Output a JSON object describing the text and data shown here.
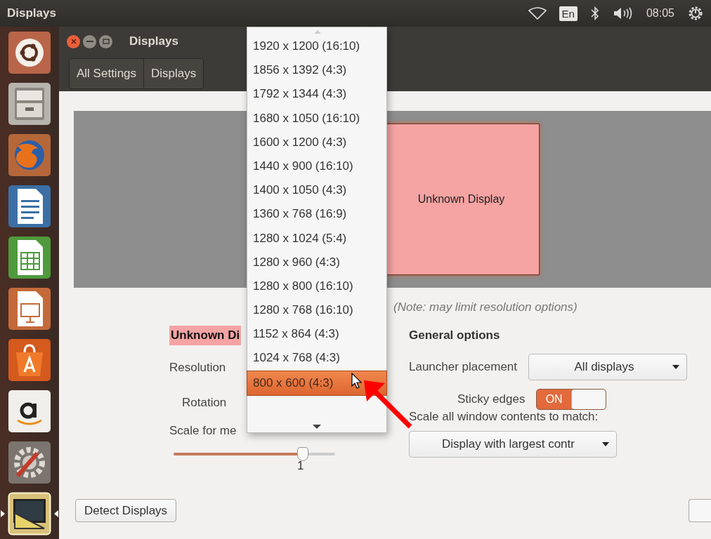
{
  "top_bar": {
    "title": "Displays",
    "keyboard": "En",
    "clock": "08:05"
  },
  "launcher": [
    {
      "kind": "ubuntu",
      "running": false
    },
    {
      "kind": "files",
      "running": false
    },
    {
      "kind": "browser",
      "running": false
    },
    {
      "kind": "writer",
      "running": false
    },
    {
      "kind": "calc",
      "running": false
    },
    {
      "kind": "impress",
      "running": false
    },
    {
      "kind": "store",
      "running": false
    },
    {
      "kind": "amazon",
      "running": false
    },
    {
      "kind": "settings",
      "running": false
    },
    {
      "kind": "display",
      "running": true
    }
  ],
  "window": {
    "title": "Displays",
    "breadcrumbs": [
      "All Settings",
      "Displays"
    ]
  },
  "preview": {
    "display_label": "Unknown Display"
  },
  "note": "(Note: may limit resolution options)",
  "display_section": {
    "heading": "Unknown Di",
    "resolution_label": "Resolution",
    "rotation_label": "Rotation",
    "scale_label": "Scale for me",
    "scale": {
      "level": 0.8,
      "value": "1"
    }
  },
  "general": {
    "heading": "General options",
    "launcher_label": "Launcher placement",
    "launcher_value": "All displays",
    "sticky_label": "Sticky edges",
    "sticky": {
      "on": true,
      "label": "ON"
    },
    "scale_all_label": "Scale all window contents to match:",
    "scale_all_value": "Display with largest contr"
  },
  "detect_button": "Detect Displays",
  "resolution_menu": [
    {
      "label": "1920 x 1200 (16:10)",
      "selected": false
    },
    {
      "label": "1856 x 1392 (4:3)",
      "selected": false
    },
    {
      "label": "1792 x 1344 (4:3)",
      "selected": false
    },
    {
      "label": "1680 x 1050 (16:10)",
      "selected": false
    },
    {
      "label": "1600 x 1200 (4:3)",
      "selected": false
    },
    {
      "label": "1440 x 900 (16:10)",
      "selected": false
    },
    {
      "label": "1400 x 1050 (4:3)",
      "selected": false
    },
    {
      "label": "1360 x 768 (16:9)",
      "selected": false
    },
    {
      "label": "1280 x 1024 (5:4)",
      "selected": false
    },
    {
      "label": "1280 x 960 (4:3)",
      "selected": false
    },
    {
      "label": "1280 x 800 (16:10)",
      "selected": false
    },
    {
      "label": "1280 x 768 (16:10)",
      "selected": false
    },
    {
      "label": "1152 x 864 (4:3)",
      "selected": false
    },
    {
      "label": "1024 x 768 (4:3)",
      "selected": false
    },
    {
      "label": "800 x 600 (4:3)",
      "selected": true
    }
  ]
}
